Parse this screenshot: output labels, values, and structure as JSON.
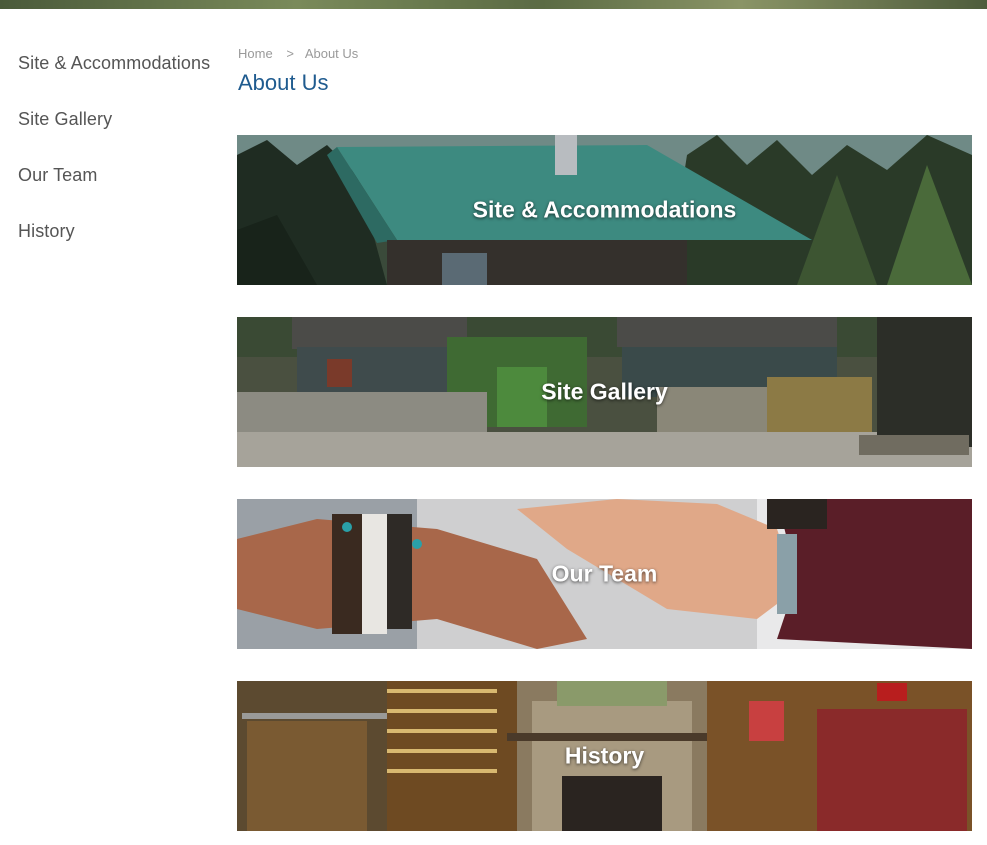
{
  "sidebar": {
    "items": [
      {
        "label": "Site & Accommodations"
      },
      {
        "label": "Site Gallery"
      },
      {
        "label": "Our Team"
      },
      {
        "label": "History"
      }
    ]
  },
  "breadcrumb": {
    "home": "Home",
    "separator": ">",
    "current": "About Us"
  },
  "page": {
    "title": "About Us"
  },
  "tiles": [
    {
      "label": "Site & Accommodations"
    },
    {
      "label": "Site Gallery"
    },
    {
      "label": "Our Team"
    },
    {
      "label": "History"
    }
  ],
  "colors": {
    "title": "#1f5b8f",
    "sidebar_text": "#555555",
    "breadcrumb_text": "#9a9a9a",
    "tile_text": "#ffffff"
  }
}
